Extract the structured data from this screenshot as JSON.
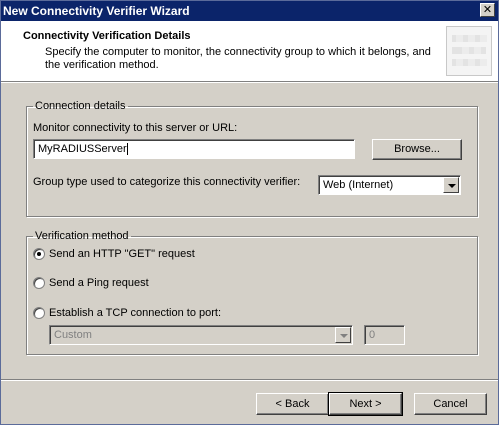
{
  "window": {
    "title": "New Connectivity Verifier Wizard",
    "close_glyph": "✕"
  },
  "header": {
    "title": "Connectivity Verification Details",
    "description": "Specify the computer to monitor, the connectivity group to which it belongs, and the verification method."
  },
  "connection": {
    "legend": "Connection details",
    "monitor_label": "Monitor connectivity to this server or URL:",
    "server_value": "MyRADIUSServer",
    "browse_label": "Browse...",
    "group_label": "Group type used to categorize this connectivity verifier:",
    "group_value": "Web (Internet)"
  },
  "verification": {
    "legend": "Verification method",
    "options": [
      {
        "label": "Send an HTTP \"GET\" request",
        "checked": true
      },
      {
        "label": "Send a Ping request",
        "checked": false
      },
      {
        "label": "Establish a TCP connection to port:",
        "checked": false
      }
    ],
    "port_combo_value": "Custom",
    "port_value": "0"
  },
  "buttons": {
    "back": "< Back",
    "next": "Next >",
    "cancel": "Cancel"
  }
}
